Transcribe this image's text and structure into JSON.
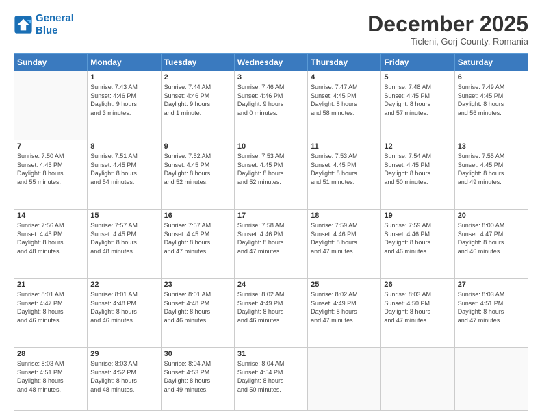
{
  "logo": {
    "line1": "General",
    "line2": "Blue"
  },
  "header": {
    "month": "December 2025",
    "location": "Ticleni, Gorj County, Romania"
  },
  "weekdays": [
    "Sunday",
    "Monday",
    "Tuesday",
    "Wednesday",
    "Thursday",
    "Friday",
    "Saturday"
  ],
  "weeks": [
    [
      {
        "day": "",
        "info": ""
      },
      {
        "day": "1",
        "info": "Sunrise: 7:43 AM\nSunset: 4:46 PM\nDaylight: 9 hours\nand 3 minutes."
      },
      {
        "day": "2",
        "info": "Sunrise: 7:44 AM\nSunset: 4:46 PM\nDaylight: 9 hours\nand 1 minute."
      },
      {
        "day": "3",
        "info": "Sunrise: 7:46 AM\nSunset: 4:46 PM\nDaylight: 9 hours\nand 0 minutes."
      },
      {
        "day": "4",
        "info": "Sunrise: 7:47 AM\nSunset: 4:45 PM\nDaylight: 8 hours\nand 58 minutes."
      },
      {
        "day": "5",
        "info": "Sunrise: 7:48 AM\nSunset: 4:45 PM\nDaylight: 8 hours\nand 57 minutes."
      },
      {
        "day": "6",
        "info": "Sunrise: 7:49 AM\nSunset: 4:45 PM\nDaylight: 8 hours\nand 56 minutes."
      }
    ],
    [
      {
        "day": "7",
        "info": "Sunrise: 7:50 AM\nSunset: 4:45 PM\nDaylight: 8 hours\nand 55 minutes."
      },
      {
        "day": "8",
        "info": "Sunrise: 7:51 AM\nSunset: 4:45 PM\nDaylight: 8 hours\nand 54 minutes."
      },
      {
        "day": "9",
        "info": "Sunrise: 7:52 AM\nSunset: 4:45 PM\nDaylight: 8 hours\nand 52 minutes."
      },
      {
        "day": "10",
        "info": "Sunrise: 7:53 AM\nSunset: 4:45 PM\nDaylight: 8 hours\nand 52 minutes."
      },
      {
        "day": "11",
        "info": "Sunrise: 7:53 AM\nSunset: 4:45 PM\nDaylight: 8 hours\nand 51 minutes."
      },
      {
        "day": "12",
        "info": "Sunrise: 7:54 AM\nSunset: 4:45 PM\nDaylight: 8 hours\nand 50 minutes."
      },
      {
        "day": "13",
        "info": "Sunrise: 7:55 AM\nSunset: 4:45 PM\nDaylight: 8 hours\nand 49 minutes."
      }
    ],
    [
      {
        "day": "14",
        "info": "Sunrise: 7:56 AM\nSunset: 4:45 PM\nDaylight: 8 hours\nand 48 minutes."
      },
      {
        "day": "15",
        "info": "Sunrise: 7:57 AM\nSunset: 4:45 PM\nDaylight: 8 hours\nand 48 minutes."
      },
      {
        "day": "16",
        "info": "Sunrise: 7:57 AM\nSunset: 4:45 PM\nDaylight: 8 hours\nand 47 minutes."
      },
      {
        "day": "17",
        "info": "Sunrise: 7:58 AM\nSunset: 4:46 PM\nDaylight: 8 hours\nand 47 minutes."
      },
      {
        "day": "18",
        "info": "Sunrise: 7:59 AM\nSunset: 4:46 PM\nDaylight: 8 hours\nand 47 minutes."
      },
      {
        "day": "19",
        "info": "Sunrise: 7:59 AM\nSunset: 4:46 PM\nDaylight: 8 hours\nand 46 minutes."
      },
      {
        "day": "20",
        "info": "Sunrise: 8:00 AM\nSunset: 4:47 PM\nDaylight: 8 hours\nand 46 minutes."
      }
    ],
    [
      {
        "day": "21",
        "info": "Sunrise: 8:01 AM\nSunset: 4:47 PM\nDaylight: 8 hours\nand 46 minutes."
      },
      {
        "day": "22",
        "info": "Sunrise: 8:01 AM\nSunset: 4:48 PM\nDaylight: 8 hours\nand 46 minutes."
      },
      {
        "day": "23",
        "info": "Sunrise: 8:01 AM\nSunset: 4:48 PM\nDaylight: 8 hours\nand 46 minutes."
      },
      {
        "day": "24",
        "info": "Sunrise: 8:02 AM\nSunset: 4:49 PM\nDaylight: 8 hours\nand 46 minutes."
      },
      {
        "day": "25",
        "info": "Sunrise: 8:02 AM\nSunset: 4:49 PM\nDaylight: 8 hours\nand 47 minutes."
      },
      {
        "day": "26",
        "info": "Sunrise: 8:03 AM\nSunset: 4:50 PM\nDaylight: 8 hours\nand 47 minutes."
      },
      {
        "day": "27",
        "info": "Sunrise: 8:03 AM\nSunset: 4:51 PM\nDaylight: 8 hours\nand 47 minutes."
      }
    ],
    [
      {
        "day": "28",
        "info": "Sunrise: 8:03 AM\nSunset: 4:51 PM\nDaylight: 8 hours\nand 48 minutes."
      },
      {
        "day": "29",
        "info": "Sunrise: 8:03 AM\nSunset: 4:52 PM\nDaylight: 8 hours\nand 48 minutes."
      },
      {
        "day": "30",
        "info": "Sunrise: 8:04 AM\nSunset: 4:53 PM\nDaylight: 8 hours\nand 49 minutes."
      },
      {
        "day": "31",
        "info": "Sunrise: 8:04 AM\nSunset: 4:54 PM\nDaylight: 8 hours\nand 50 minutes."
      },
      {
        "day": "",
        "info": ""
      },
      {
        "day": "",
        "info": ""
      },
      {
        "day": "",
        "info": ""
      }
    ]
  ]
}
